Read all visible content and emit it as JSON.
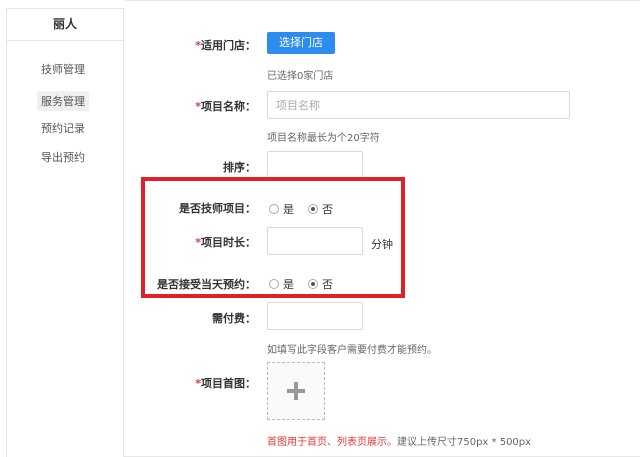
{
  "sidebar": {
    "title": "丽人",
    "items": [
      {
        "label": "技师管理",
        "active": false
      },
      {
        "label": "服务管理",
        "active": true
      },
      {
        "label": "预约记录",
        "active": false
      },
      {
        "label": "导出预约",
        "active": false
      }
    ]
  },
  "form": {
    "stores": {
      "required": "*",
      "label": "适用门店：",
      "button": "选择门店",
      "hint": "已选择0家门店"
    },
    "name": {
      "required": "*",
      "label": "项目名称：",
      "placeholder": "项目名称",
      "value": "",
      "hint": "项目名称最长为个20字符"
    },
    "sort": {
      "label": "排序：",
      "value": ""
    },
    "is_technician": {
      "label": "是否技师项目：",
      "options": [
        "是",
        "否"
      ],
      "selected": "否"
    },
    "duration": {
      "required": "*",
      "label": "项目时长：",
      "value": "",
      "unit": "分钟"
    },
    "same_day": {
      "label": "是否接受当天预约：",
      "options": [
        "是",
        "否"
      ],
      "selected": "否"
    },
    "fee": {
      "label": "需付费：",
      "value": "",
      "hint": "如填写此字段客户需要付费才能预约。"
    },
    "cover": {
      "required": "*",
      "label": "项目首图：",
      "hint_red": "首图用于首页、列表页展示。",
      "hint": "建议上传尺寸750px * 500px"
    }
  },
  "colors": {
    "primary": "#2d8cf0",
    "highlight": "#e0202a",
    "required": "#e53935"
  }
}
